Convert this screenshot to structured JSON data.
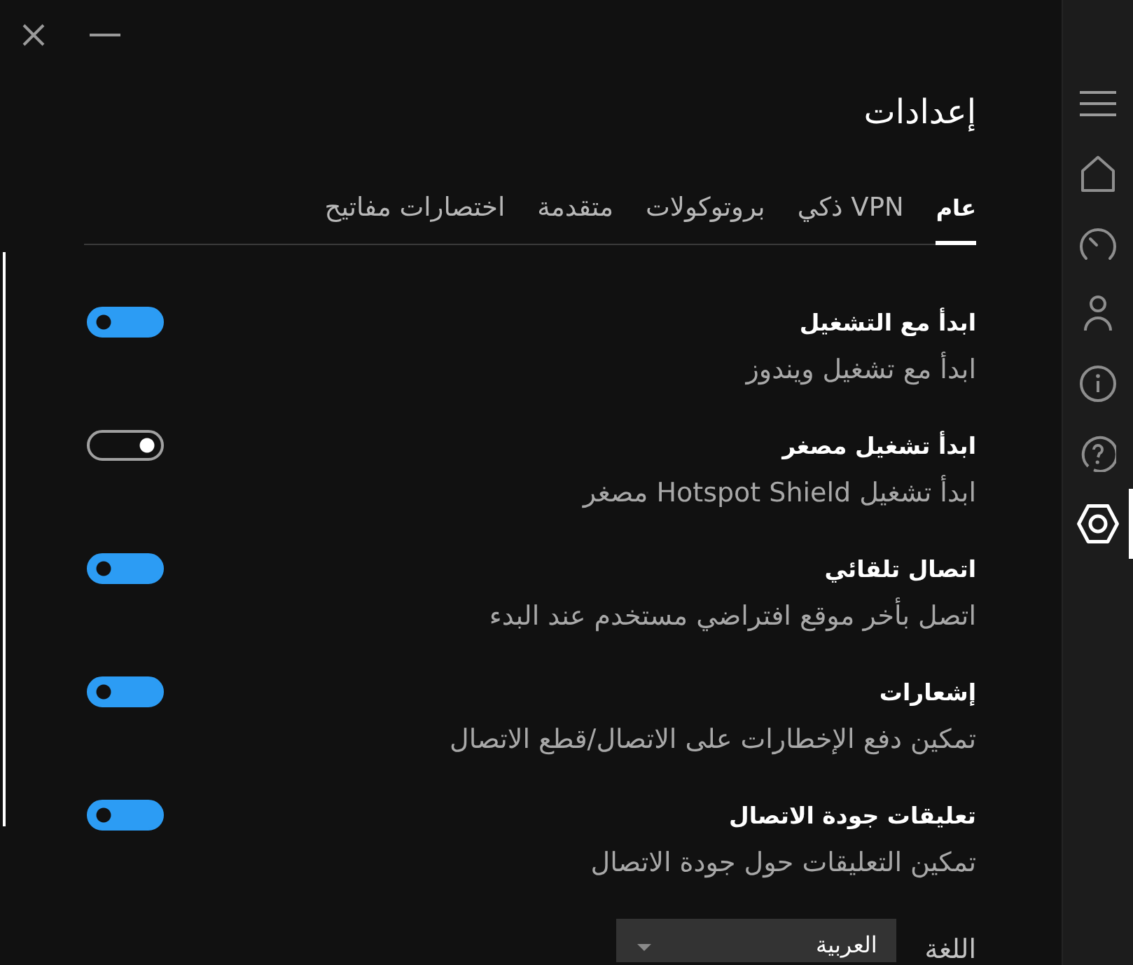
{
  "title": "إعدادات",
  "tabs": [
    {
      "label": "عام",
      "selected": true
    },
    {
      "label": "VPN ذكي",
      "selected": false
    },
    {
      "label": "بروتوكولات",
      "selected": false
    },
    {
      "label": "متقدمة",
      "selected": false
    },
    {
      "label": "اختصارات مفاتيح",
      "selected": false
    }
  ],
  "settings": [
    {
      "title": "ابدأ مع التشغيل",
      "description": "ابدأ مع تشغيل ويندوز",
      "on": true
    },
    {
      "title": "ابدأ تشغيل مصغر",
      "description": "ابدأ تشغيل Hotspot Shield مصغر",
      "on": false
    },
    {
      "title": "اتصال تلقائي",
      "description": "اتصل بأخر موقع افتراضي مستخدم عند البدء",
      "on": true
    },
    {
      "title": "إشعارات",
      "description": "تمكين دفع الإخطارات على الاتصال/قطع الاتصال",
      "on": true
    },
    {
      "title": "تعليقات جودة الاتصال",
      "description": "تمكين التعليقات حول جودة الاتصال",
      "on": true
    }
  ],
  "language": {
    "label": "اللغة",
    "value": "العربية"
  },
  "sidebar": {
    "items": [
      {
        "kind": "home",
        "selected": false
      },
      {
        "kind": "speed",
        "selected": false
      },
      {
        "kind": "account",
        "selected": false
      },
      {
        "kind": "info",
        "selected": false
      },
      {
        "kind": "help",
        "selected": false
      },
      {
        "kind": "settings",
        "selected": true
      }
    ]
  }
}
